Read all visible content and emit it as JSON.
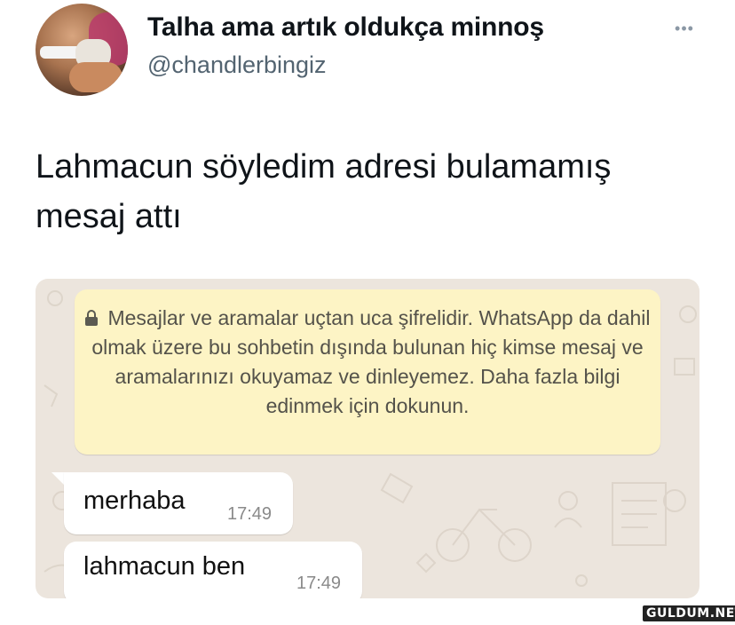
{
  "tweet": {
    "display_name": "Talha ama artık oldukça minnoş",
    "handle": "@chandlerbingiz",
    "more_icon": "ellipsis-icon",
    "text": "Lahmacun söyledim adresi bulamamış mesaj attı"
  },
  "chat": {
    "encryption_notice": "Mesajlar ve aramalar uçtan uca şifrelidir. WhatsApp da dahil olmak üzere bu sohbetin dışında bulunan hiç kimse mesaj ve aramalarınızı okuyamaz ve dinleyemez. Daha fazla bilgi edinmek için dokunun.",
    "notice_icon": "lock-icon",
    "messages": [
      {
        "text": "merhaba",
        "time": "17:49"
      },
      {
        "text": "lahmacun ben",
        "time": "17:49"
      }
    ],
    "colors": {
      "wallpaper": "#ece5dd",
      "notice_bg": "#fdf4c5",
      "bubble_bg": "#ffffff"
    }
  },
  "watermark": "GULDUM.NET"
}
